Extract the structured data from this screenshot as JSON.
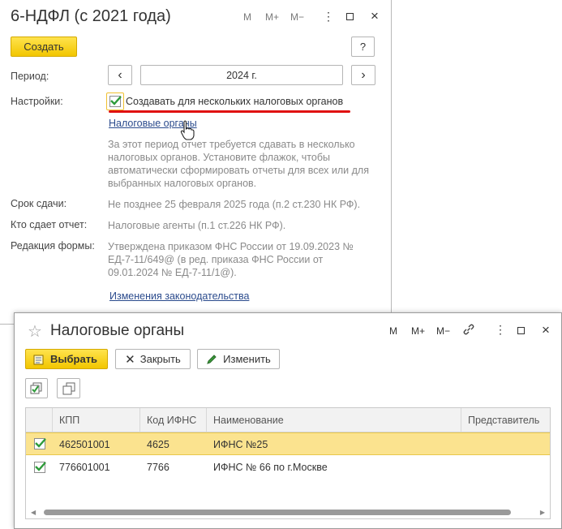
{
  "form": {
    "title": "6-НДФЛ (с 2021 года)",
    "window_controls": [
      "M",
      "M+",
      "M−"
    ],
    "create_label": "Создать",
    "help_label": "?",
    "period_label": "Период:",
    "period_value": "2024 г.",
    "prev_label": "‹",
    "next_label": "›",
    "settings_label": "Настройки:",
    "multi_checkbox_label": "Создавать для нескольких налоговых органов",
    "tax_orgs_link": "Налоговые органы",
    "hint": "За этот период отчет требуется сдавать в несколько налоговых органов. Установите флажок, чтобы автоматически сформировать отчеты для всех или для выбранных налоговых органов.",
    "deadline_label": "Срок сдачи:",
    "deadline_value": "Не позднее 25 февраля 2025 года (п.2 ст.230 НК РФ).",
    "submitter_label": "Кто сдает отчет:",
    "submitter_value": "Налоговые агенты (п.1 ст.226 НК РФ).",
    "edition_label": "Редакция формы:",
    "edition_value": "Утверждена приказом ФНС России от 19.09.2023 № ЕД-7-11/649@ (в ред. приказа ФНС России от 09.01.2024 № ЕД-7-11/1@).",
    "law_changes_link": "Изменения законодательства"
  },
  "dialog": {
    "title": "Налоговые органы",
    "window_controls": [
      "M",
      "M+",
      "M−"
    ],
    "select_label": "Выбрать",
    "close_label": "Закрыть",
    "edit_label": "Изменить",
    "columns": [
      "КПП",
      "Код ИФНС",
      "Наименование",
      "Представитель"
    ],
    "rows": [
      {
        "checked": true,
        "kpp": "462501001",
        "code": "4625",
        "name": "ИФНС №25",
        "rep": ""
      },
      {
        "checked": true,
        "kpp": "776601001",
        "code": "7766",
        "name": "ИФНС № 66 по г.Москве",
        "rep": ""
      }
    ]
  },
  "colors": {
    "accent_yellow": "#f2c600",
    "selected_row": "#fbe38f",
    "link": "#2b4b8d",
    "check_green": "#2e9b3a",
    "underline_red": "#e01010"
  }
}
